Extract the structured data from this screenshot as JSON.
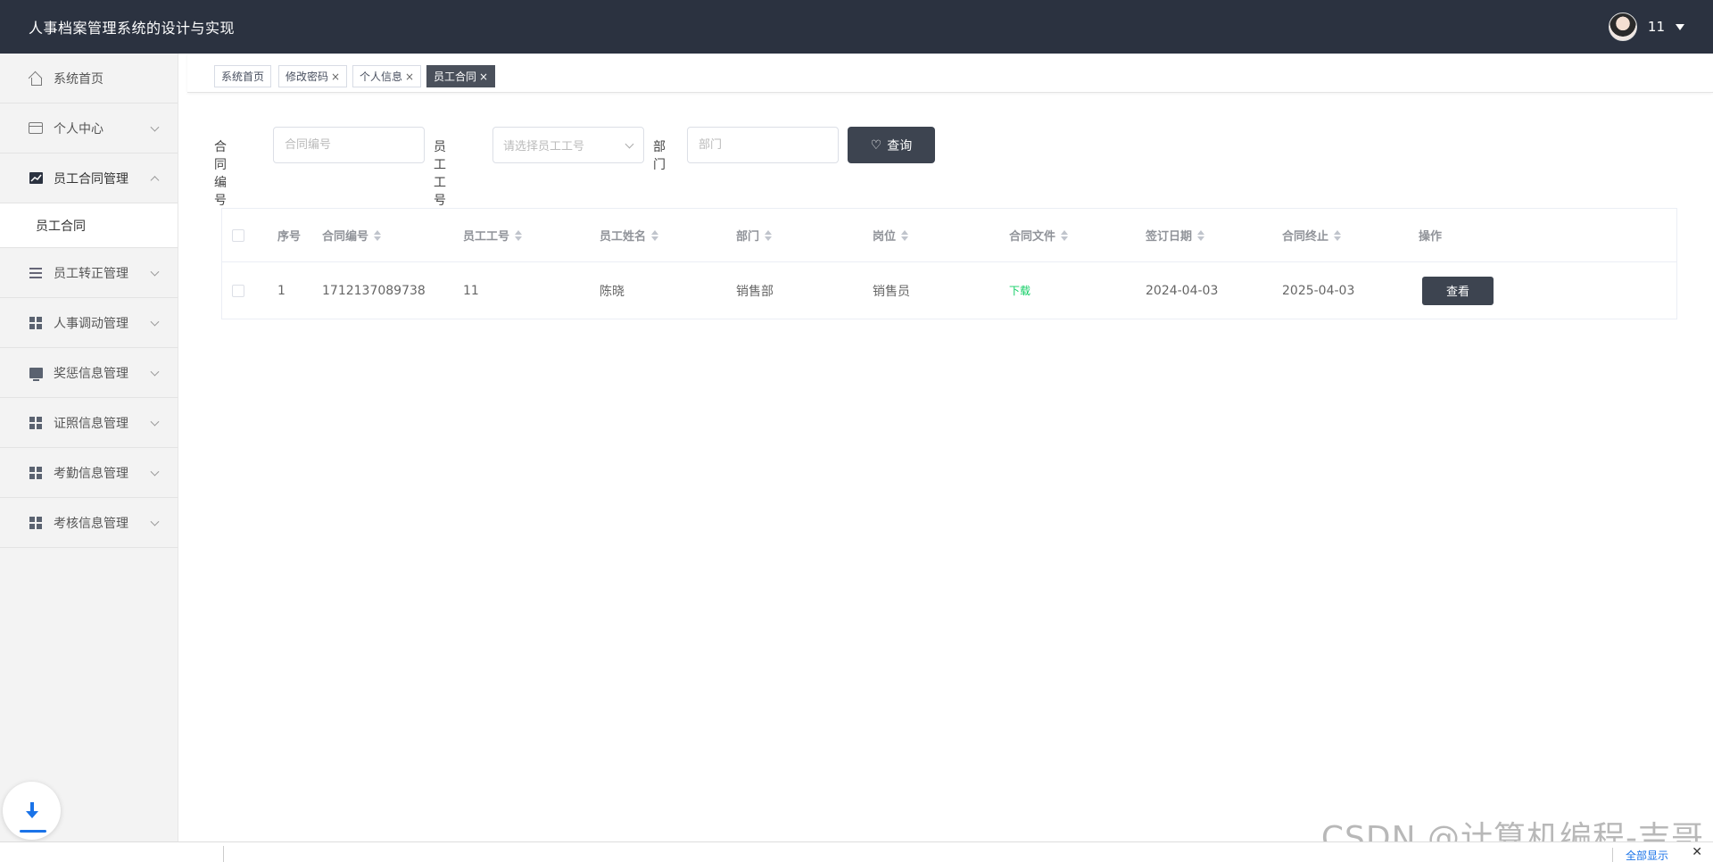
{
  "header": {
    "title": "人事档案管理系统的设计与实现",
    "username": "11"
  },
  "sidebar": {
    "items": [
      {
        "label": "系统首页",
        "icon": "home-icon"
      },
      {
        "label": "个人中心",
        "icon": "card-icon"
      },
      {
        "label": "员工合同管理",
        "icon": "chart-icon",
        "expanded": true
      },
      {
        "label": "员工转正管理",
        "icon": "list-icon"
      },
      {
        "label": "人事调动管理",
        "icon": "grid-icon"
      },
      {
        "label": "奖惩信息管理",
        "icon": "monitor-icon"
      },
      {
        "label": "证照信息管理",
        "icon": "grid-icon"
      },
      {
        "label": "考勤信息管理",
        "icon": "grid-icon"
      },
      {
        "label": "考核信息管理",
        "icon": "grid-icon"
      }
    ],
    "sub_item": "员工合同"
  },
  "tabs": [
    {
      "label": "系统首页",
      "closable": false
    },
    {
      "label": "修改密码",
      "closable": true
    },
    {
      "label": "个人信息",
      "closable": true
    },
    {
      "label": "员工合同",
      "closable": true,
      "active": true
    }
  ],
  "tab_close_glyph": "×",
  "search": {
    "contract_no_label": "合同编号",
    "contract_no_placeholder": "合同编号",
    "employee_no_label": "员工工号",
    "employee_no_placeholder": "请选择员工工号",
    "dept_label": "部门",
    "dept_placeholder": "部门",
    "query_button": "查询"
  },
  "table": {
    "columns": [
      "序号",
      "合同编号",
      "员工工号",
      "员工姓名",
      "部门",
      "岗位",
      "合同文件",
      "签订日期",
      "合同终止",
      "操作"
    ],
    "rows": [
      {
        "index": "1",
        "contract_no": "1712137089738",
        "employee_no": "11",
        "name": "陈晓",
        "dept": "销售部",
        "position": "销售员",
        "file": "下载",
        "sign_date": "2024-04-03",
        "end_date": "2025-04-03",
        "action": "查看"
      }
    ]
  },
  "bottom_bar": {
    "show_all": "全部显示",
    "close": "✕"
  },
  "watermark": "CSDN @计算机编程-吉哥",
  "colors": {
    "header_bg": "#2b3240",
    "primary_button": "#3d4450",
    "download_link": "#13ce66",
    "active_tab": "#4a505b"
  }
}
